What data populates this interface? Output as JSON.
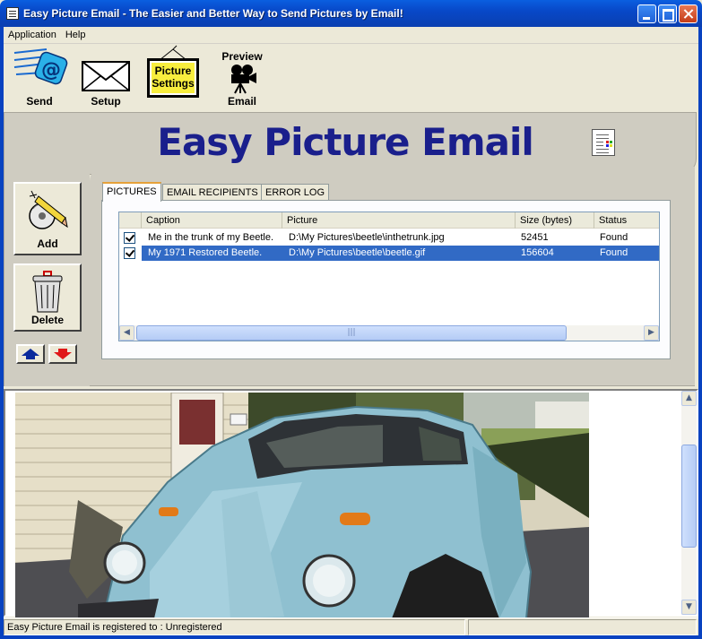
{
  "window": {
    "title": "Easy Picture Email - The Easier and Better Way to Send Pictures by Email!"
  },
  "menu": [
    "Application",
    "Help"
  ],
  "toolbar": {
    "send": "Send",
    "setup": "Setup",
    "picture_settings_line1": "Picture",
    "picture_settings_line2": "Settings",
    "preview_top": "Preview",
    "preview_bottom": "Email"
  },
  "banner": {
    "title": "Easy Picture Email"
  },
  "side": {
    "add": "Add",
    "delete": "Delete"
  },
  "tabs": [
    "PICTURES",
    "EMAIL RECIPIENTS",
    "ERROR LOG"
  ],
  "active_tab": "PICTURES",
  "list": {
    "columns": [
      "Caption",
      "Picture",
      "Size (bytes)",
      "Status"
    ],
    "rows": [
      {
        "checked": true,
        "caption": "Me in the trunk of my Beetle.",
        "picture": "D:\\My Pictures\\beetle\\inthetrunk.jpg",
        "size": "52451",
        "status": "Found",
        "selected": false
      },
      {
        "checked": true,
        "caption": "My 1971 Restored Beetle.",
        "picture": "D:\\My Pictures\\beetle\\beetle.gif",
        "size": "156604",
        "status": "Found",
        "selected": true
      }
    ]
  },
  "status": {
    "text": "Easy Picture Email is registered to : Unregistered"
  },
  "colors": {
    "title_blue": "#0a4fd0",
    "banner_text": "#1a1f8c",
    "selection": "#316ac5",
    "car_body": "#8fc0d0"
  }
}
